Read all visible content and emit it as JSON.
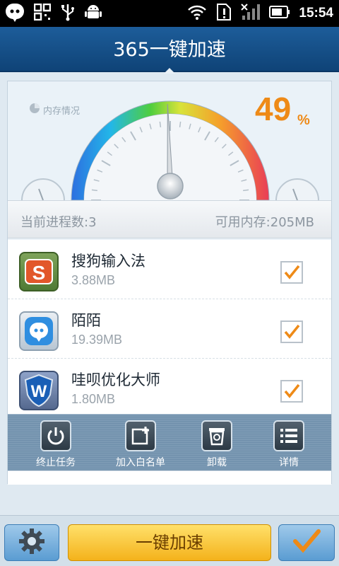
{
  "status_bar": {
    "time": "15:54",
    "left_icons": [
      "chat-bubble-icon",
      "qr-grid-icon",
      "usb-icon",
      "android-icon"
    ],
    "right_icons": [
      "wifi-icon",
      "sim-alert-icon",
      "signal-icon",
      "battery-icon"
    ]
  },
  "header": {
    "title": "365一键加速"
  },
  "memory": {
    "label": "内存情况",
    "percent": "49",
    "percent_sign": "%",
    "percent_value": 49
  },
  "process_bar": {
    "current_processes": "当前进程数:3",
    "available_memory": "可用内存:205MB"
  },
  "apps": [
    {
      "name": "搜狗输入法",
      "size": "3.88MB",
      "icon": "sogou-icon",
      "checked": true,
      "icon_color": "#d5542c"
    },
    {
      "name": "陌陌",
      "size": "19.39MB",
      "icon": "momo-icon",
      "checked": true,
      "icon_color": "#2f8ee0"
    },
    {
      "name": "哇呗优化大师",
      "size": "1.80MB",
      "icon": "wabei-shield-icon",
      "checked": true,
      "icon_color": "#1a5fb6"
    }
  ],
  "toolbar": {
    "end_task": "终止任务",
    "add_whitelist": "加入白名单",
    "uninstall": "卸载",
    "details": "详情"
  },
  "bottom": {
    "speed_button": "一键加速"
  },
  "colors": {
    "title_bar": "#1d5d9a",
    "accent_orange": "#ee8a17",
    "speed_button": "#f4b21b",
    "check_orange": "#ee8a17"
  }
}
